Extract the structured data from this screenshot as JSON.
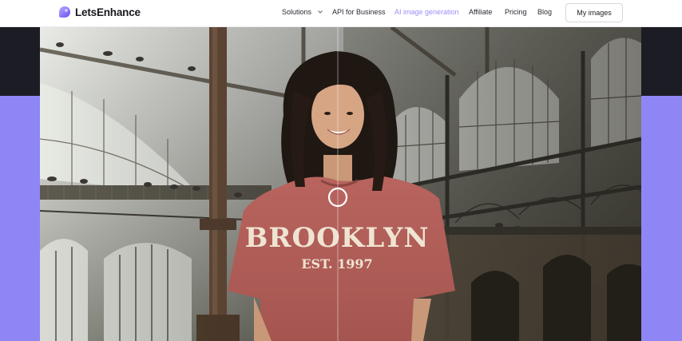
{
  "header": {
    "brand": "LetsEnhance",
    "nav": [
      {
        "label": "Solutions",
        "has_dropdown": true
      },
      {
        "label": "API for Business"
      },
      {
        "label": "AI image generation",
        "active": true
      },
      {
        "label": "Affiliate"
      },
      {
        "label": "Pricing"
      },
      {
        "label": "Blog"
      }
    ],
    "cta": "My images"
  },
  "photo": {
    "shirt_line1": "BROOKLYN",
    "shirt_line2": "EST. 1997"
  },
  "colors": {
    "accent": "#9a8ff5",
    "brand_purple": "#8f86f5",
    "dark_band": "#1c1c24",
    "text": "#18181f"
  }
}
